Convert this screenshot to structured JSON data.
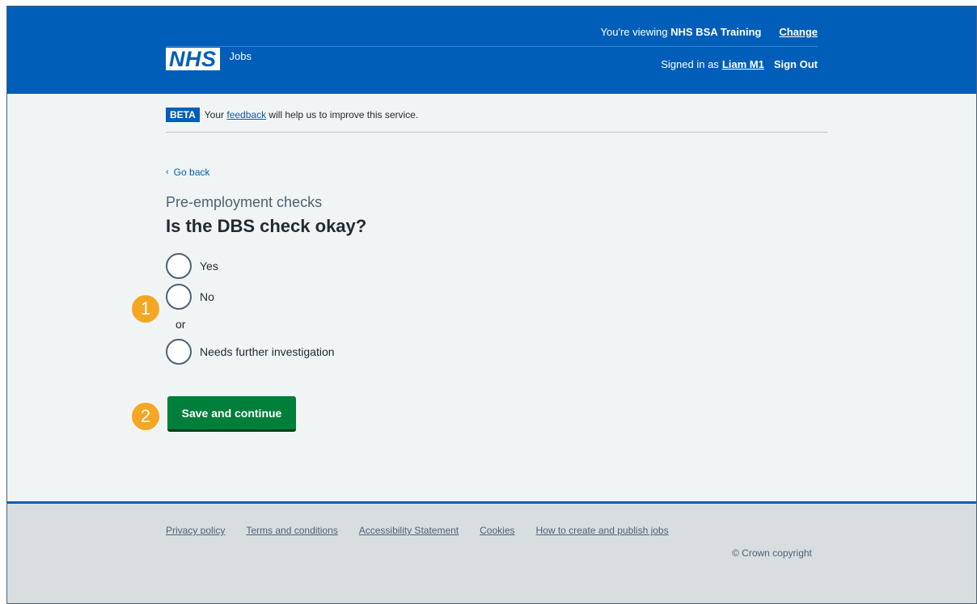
{
  "header": {
    "viewing_prefix": "You're viewing",
    "viewing_org": "NHS BSA Training",
    "change_link": "Change",
    "logo_text": "NHS",
    "service_name": "Jobs",
    "signed_in_prefix": "Signed in as",
    "user_name": "Liam M1",
    "sign_out": "Sign Out"
  },
  "beta": {
    "tag": "BETA",
    "text_before": "Your",
    "feedback_link": "feedback",
    "text_after": "will help us to improve this service."
  },
  "back_link": "Go back",
  "caption": "Pre-employment checks",
  "heading": "Is the DBS check okay?",
  "options": [
    {
      "label": "Yes"
    },
    {
      "label": "No"
    },
    {
      "label": "Needs further investigation"
    }
  ],
  "or_text": "or",
  "markers": [
    "1",
    "2"
  ],
  "save_button": "Save and continue",
  "footer": {
    "links": [
      "Privacy policy",
      "Terms and conditions",
      "Accessibility Statement",
      "Cookies",
      "How to create and publish jobs"
    ],
    "copyright": "© Crown copyright"
  },
  "colors": {
    "header_blue": "#005eb8",
    "button_green": "#007f3b",
    "marker_orange": "#f5a623",
    "background": "#f0f4f5"
  }
}
